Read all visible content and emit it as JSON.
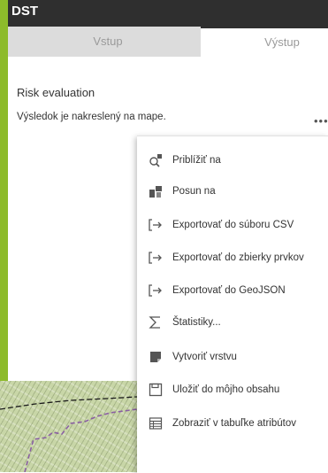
{
  "app": {
    "title": "DST"
  },
  "tabs": [
    {
      "label": "Vstup"
    },
    {
      "label": "Výstup"
    }
  ],
  "panel": {
    "section_title": "Risk evaluation",
    "result_text": "Výsledok je nakreslený na mape.",
    "more_label": "•••"
  },
  "menu": {
    "items": [
      {
        "label": "Priblížiť na",
        "icon": "zoom-to-icon"
      },
      {
        "label": "Posun na",
        "icon": "pan-to-icon"
      },
      {
        "label": "Exportovať do súboru CSV",
        "icon": "export-icon"
      },
      {
        "label": "Exportovať do zbierky prvkov",
        "icon": "export-icon"
      },
      {
        "label": "Exportovať do GeoJSON",
        "icon": "export-icon"
      },
      {
        "label": "Štatistiky...",
        "icon": "sigma-icon"
      },
      {
        "label": "Vytvoriť vrstvu",
        "icon": "layer-icon"
      },
      {
        "label": "Uložiť do môjho obsahu",
        "icon": "save-icon"
      },
      {
        "label": "Zobraziť v tabuľke atribútov",
        "icon": "table-icon"
      }
    ]
  },
  "colors": {
    "accent": "#8dbb2b",
    "titlebar": "#2f2f2f",
    "tab_inactive": "#dcdcdc"
  }
}
